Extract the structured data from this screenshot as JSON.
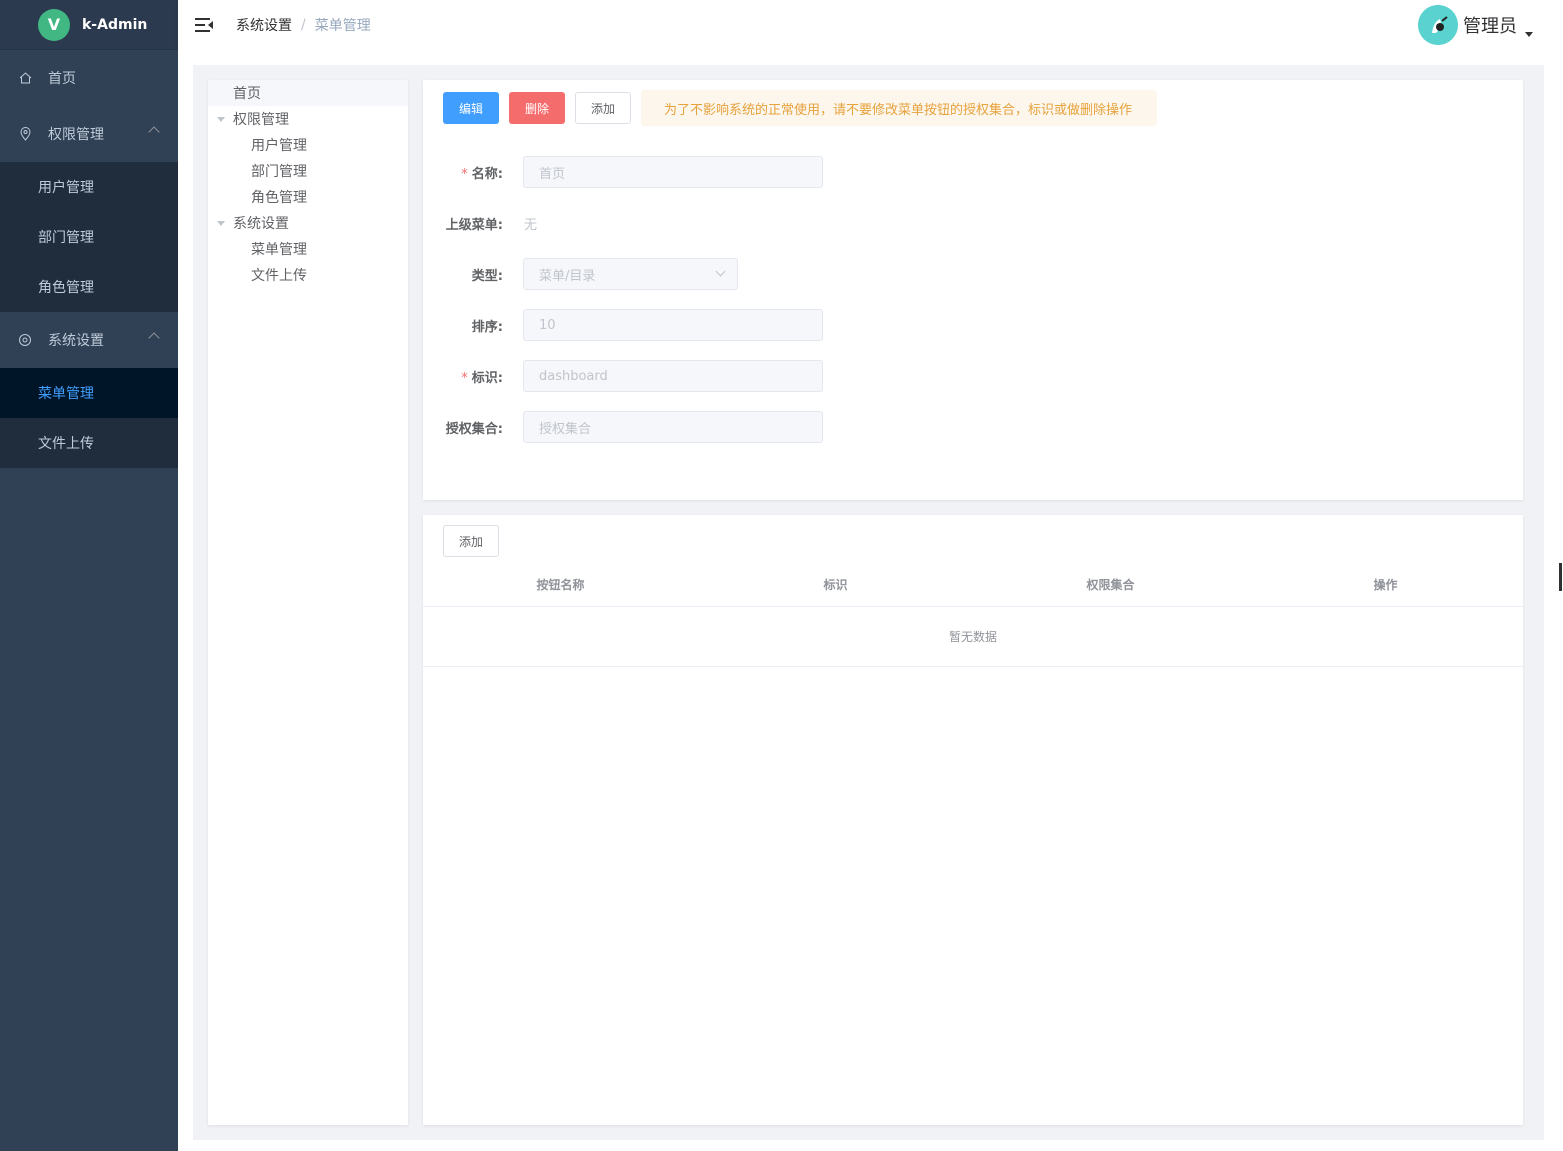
{
  "app": {
    "title": "k-Admin",
    "logo_letter": "V"
  },
  "sidebar": {
    "home": "首页",
    "permission": {
      "label": "权限管理",
      "items": [
        "用户管理",
        "部门管理",
        "角色管理"
      ]
    },
    "system": {
      "label": "系统设置",
      "items": [
        "菜单管理",
        "文件上传"
      ]
    }
  },
  "header": {
    "breadcrumb": [
      "系统设置",
      "菜单管理"
    ],
    "separator": "/",
    "user_name": "管理员"
  },
  "tree": {
    "nodes": [
      {
        "label": "首页",
        "level": 0,
        "expandable": false,
        "current": true
      },
      {
        "label": "权限管理",
        "level": 0,
        "expandable": true
      },
      {
        "label": "用户管理",
        "level": 1,
        "expandable": false
      },
      {
        "label": "部门管理",
        "level": 1,
        "expandable": false
      },
      {
        "label": "角色管理",
        "level": 1,
        "expandable": false
      },
      {
        "label": "系统设置",
        "level": 0,
        "expandable": true
      },
      {
        "label": "菜单管理",
        "level": 1,
        "expandable": false
      },
      {
        "label": "文件上传",
        "level": 1,
        "expandable": false
      }
    ]
  },
  "form": {
    "edit_button": "编辑",
    "delete_button": "删除",
    "add_button": "添加",
    "warning": "为了不影响系统的正常使用，请不要修改菜单按钮的授权集合，标识或做删除操作",
    "name_label": "名称:",
    "name_value": "首页",
    "parent_label": "上级菜单:",
    "parent_value": "无",
    "type_label": "类型:",
    "type_value": "菜单/目录",
    "order_label": "排序:",
    "order_value": "10",
    "key_label": "标识:",
    "key_value": "dashboard",
    "perms_label": "授权集合:",
    "perms_placeholder": "授权集合",
    "required_mark": "*"
  },
  "table": {
    "add_button": "添加",
    "columns": [
      "按钮名称",
      "标识",
      "权限集合",
      "操作"
    ],
    "empty_text": "暂无数据"
  },
  "colors": {
    "sidebar_bg": "#304156",
    "active_text": "#409eff",
    "primary": "#409eff",
    "danger": "#f56c6c",
    "warning_text": "#e6a23c"
  }
}
